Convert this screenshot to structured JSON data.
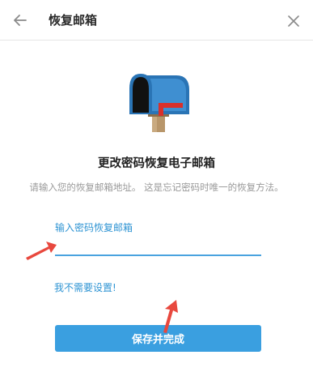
{
  "header": {
    "title": "恢复邮箱",
    "back_icon": "back-arrow-icon",
    "close_icon": "close-icon"
  },
  "main": {
    "illustration": "mailbox-icon",
    "heading": "更改密码恢复电子邮箱",
    "description": "请输入您的恢复邮箱地址。 这是忘记密码时唯一的恢复方法。",
    "email_label": "输入密码恢复邮箱",
    "email_value": "",
    "skip_link": "我不需要设置!",
    "save_button": "保存并完成"
  },
  "colors": {
    "accent": "#3a9fe0",
    "link": "#2f94d3",
    "annotation_arrow": "#e8483e"
  }
}
